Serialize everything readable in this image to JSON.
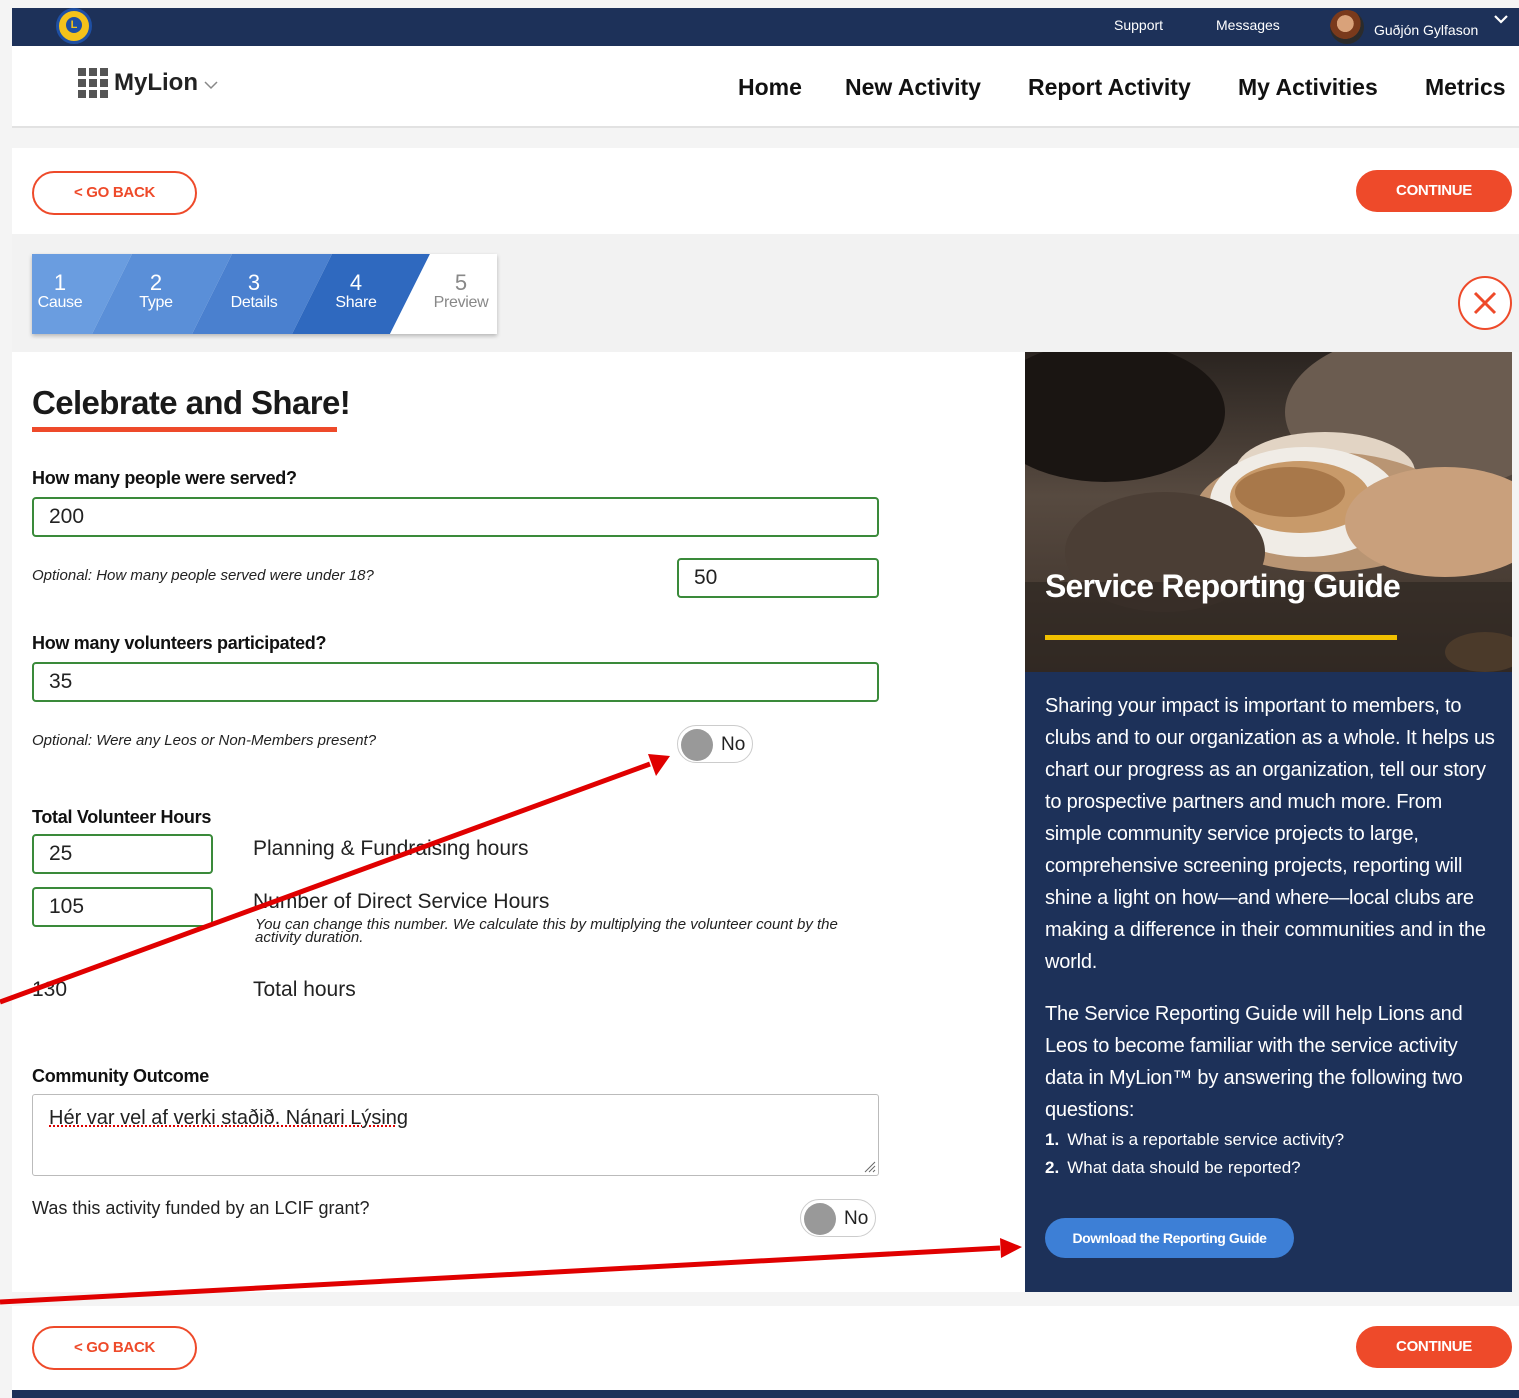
{
  "topbar": {
    "support": "Support",
    "messages": "Messages",
    "user_name": "Guðjón Gylfason"
  },
  "nav": {
    "brand": "MyLion",
    "items": [
      "Home",
      "New Activity",
      "Report Activity",
      "My Activities",
      "Metrics"
    ]
  },
  "buttons": {
    "go_back": "< GO BACK",
    "continue": "CONTINUE"
  },
  "steps": [
    {
      "num": "1",
      "label": "Cause"
    },
    {
      "num": "2",
      "label": "Type"
    },
    {
      "num": "3",
      "label": "Details"
    },
    {
      "num": "4",
      "label": "Share"
    },
    {
      "num": "5",
      "label": "Preview"
    }
  ],
  "form": {
    "heading": "Celebrate and Share!",
    "people_served_label": "How many people were served?",
    "people_served_value": "200",
    "under18_label": "Optional: How many people served were under 18?",
    "under18_value": "50",
    "volunteers_label": "How many volunteers participated?",
    "volunteers_value": "35",
    "leos_label": "Optional: Were any Leos or Non-Members present?",
    "leos_toggle": "No",
    "hours_label": "Total Volunteer Hours",
    "planning_value": "25",
    "planning_label": "Planning & Fundraising hours",
    "direct_value": "105",
    "direct_label": "Number of Direct Service Hours",
    "direct_note": "You can change this number. We calculate this by multiplying the volunteer count by the activity duration.",
    "total_value": "130",
    "total_label": "Total hours",
    "outcome_label": "Community Outcome",
    "outcome_value": "Hér var vel af verki staðið. Nánari Lýsing",
    "lcif_label": "Was this activity funded by an LCIF grant?",
    "lcif_toggle": "No"
  },
  "guide": {
    "title": "Service Reporting Guide",
    "para1": "Sharing your impact is important to members, to clubs and to our organization as a whole. It helps us chart our progress as an organization, tell our story to prospective partners and much more. From simple community service projects to large, comprehensive screening projects, reporting will shine a light on how—and where—local clubs are making a difference in their communities and in the world.",
    "para2": "The Service Reporting Guide will help Lions and Leos to become familiar with the service activity data in MyLion™ by answering the following two questions:",
    "questions": [
      {
        "num": "1.",
        "text": "What is a reportable service activity?"
      },
      {
        "num": "2.",
        "text": "What data should be reported?"
      }
    ],
    "download": "Download the Reporting Guide"
  },
  "colors": {
    "navy": "#1d3159",
    "accent": "#ee4a2a",
    "step_blue": "#3a6fc2",
    "guide_yellow": "#f0c000",
    "input_border": "#3a8a3a",
    "annotation_arrow": "#e00000"
  },
  "icons": [
    "lions-logo",
    "grid-icon",
    "chevron-down-icon",
    "close-icon",
    "resize-handle-icon",
    "avatar"
  ]
}
